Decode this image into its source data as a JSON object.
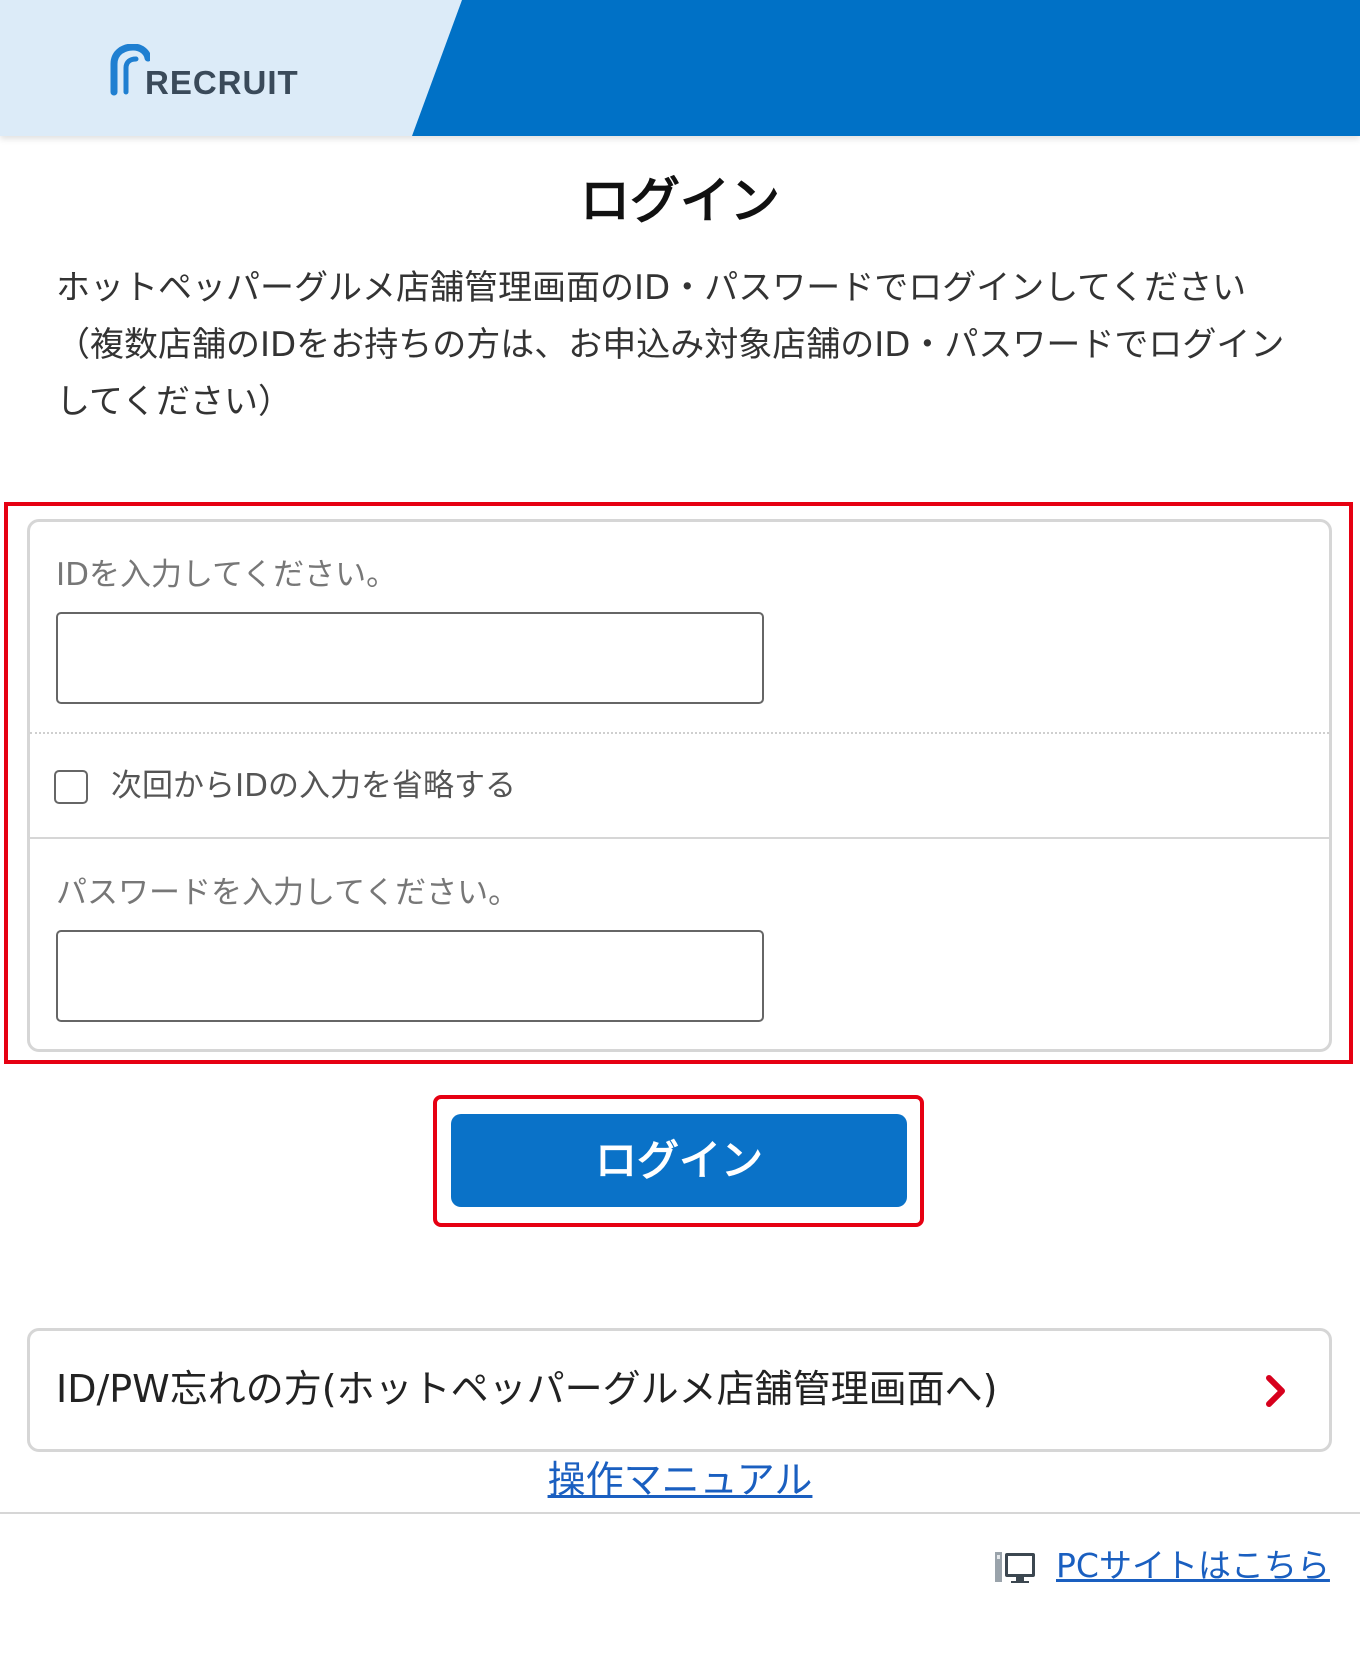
{
  "header": {
    "logo_text": "RECRUIT",
    "colors": {
      "primary": "#0071c6",
      "light": "#dcebf8"
    }
  },
  "page_title": "ログイン",
  "description": {
    "line1": "ホットペッパーグルメ店舗管理画面のID・パスワードでログインしてください",
    "line2": "（複数店舗のIDをお持ちの方は、お申込み対象店舗のID・パスワードでログインしてください）"
  },
  "form": {
    "id_label": "IDを入力してください。",
    "id_value": "",
    "remember_label": "次回からIDの入力を省略する",
    "remember_checked": false,
    "password_label": "パスワードを入力してください。",
    "password_value": ""
  },
  "login_button": {
    "label": "ログイン",
    "color": "#0a72c8"
  },
  "forgot_link": {
    "label": "ID/PW忘れの方(ホットペッパーグルメ店舗管理画面へ)",
    "icon": "chevron-right-icon",
    "icon_color": "#d7001d"
  },
  "manual_link": "操作マニュアル",
  "pc_site": {
    "label": "PCサイトはこちら",
    "icon": "pc-monitor-icon"
  },
  "highlight_color": "#e60012"
}
